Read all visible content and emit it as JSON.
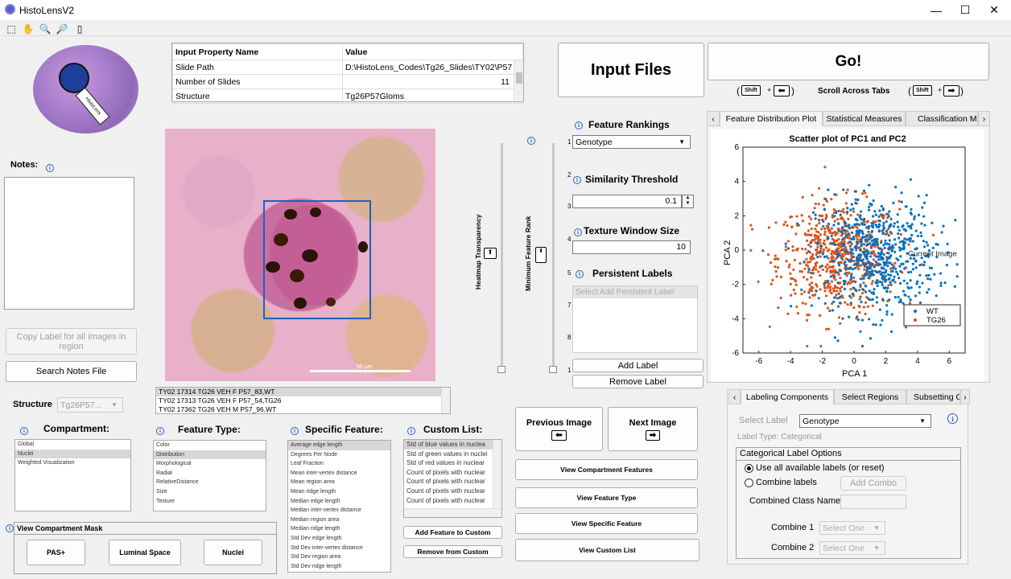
{
  "app": {
    "title": "HistoLensV2",
    "logo_text": "HistoLens"
  },
  "window": {
    "minimize": "—",
    "maximize": "☐",
    "close": "✕"
  },
  "toolbar": [
    "select-icon",
    "pan-icon",
    "zoom-in-icon",
    "zoom-out-icon",
    "data-cursor-icon"
  ],
  "input_table": {
    "headers": [
      "Input Property Name",
      "Value"
    ],
    "rows": [
      [
        "Slide Path",
        "D:\\HistoLens_Codes\\Tg26_Slides\\TY02\\P57"
      ],
      [
        "Number of Slides",
        "11"
      ],
      [
        "Structure",
        "Tg26P57Gloms"
      ]
    ]
  },
  "buttons": {
    "input_files": "Input Files",
    "go": "Go!",
    "copy_label": "Copy Label for all images in region",
    "search_notes": "Search Notes File",
    "previous_image": "Previous Image",
    "next_image": "Next Image",
    "view_compartment_features": "View Compartment Features",
    "view_feature_type": "View Feature Type",
    "view_specific_feature": "View Specific Feature",
    "view_custom_list": "View Custom List",
    "add_feature_to_custom": "Add Feature to Custom",
    "remove_from_custom": "Remove from Custom",
    "add_label": "Add Label",
    "remove_label": "Remove Label",
    "add_combo": "Add Combo",
    "pas": "PAS+",
    "luminal_space": "Luminal Space",
    "nuclei": "Nuclei"
  },
  "scroll_hint": {
    "shift": "Shift",
    "text": "Scroll Across Tabs",
    "plus": "+"
  },
  "notes": {
    "label": "Notes:"
  },
  "structure": {
    "label": "Structure",
    "value": "Tg26P57..."
  },
  "image": {
    "scale_label": "50 µm"
  },
  "image_list": [
    "TY02 17314 TG26 VEH F P57_83,WT",
    "TY02 17313 TG26 VEH F P57_54,TG26",
    "TY02 17362 TG26 VEH M P57_96,WT"
  ],
  "sliders": {
    "heatmap_label": "Heatmap Transparency",
    "rank_label": "Minimum Feature Rank",
    "ticks": [
      "1",
      "2",
      "3",
      "4",
      "5",
      "6",
      "7",
      "8",
      "1"
    ]
  },
  "feature_rankings": {
    "label": "Feature Rankings",
    "value": "Genotype"
  },
  "similarity": {
    "label": "Similarity Threshold",
    "value": "0.1"
  },
  "texture": {
    "label": "Texture Window Size",
    "value": "10"
  },
  "persistent": {
    "label": "Persistent Labels",
    "placeholder": "Select Add Persistent Label"
  },
  "compartment": {
    "label": "Compartment:",
    "items": [
      "Global",
      "Nuclei",
      "Weighted Visualization"
    ],
    "selected": 1
  },
  "feature_type": {
    "label": "Feature Type:",
    "items": [
      "Color",
      "Distribution",
      "Morphological",
      "Radial",
      "RelativeDistance",
      "Size",
      "Texture"
    ],
    "selected": 1
  },
  "specific_feature": {
    "label": "Specific Feature:",
    "items": [
      "Average edge length",
      "Degrees Per Node",
      "Leaf Fraction",
      "Mean inter-vertex distance",
      "Mean region area",
      "Mean ridge length",
      "Median edge length",
      "Median inter-vertex distance",
      "Median region area",
      "Median ridge length",
      "Std Dev edge length",
      "Std Dev inter-vertex distance",
      "Std Dev region area",
      "Std Dev ridge length"
    ],
    "selected": 0
  },
  "custom_list": {
    "label": "Custom List:",
    "items": [
      "Std of blue values in nuclea",
      "Std of green values in nuclei",
      "Std of red values in nuclear",
      "Count of pixels with nuclear",
      "Count of pixels with nuclear",
      "Count of pixels with nuclear",
      "Count of pixels with nuclear"
    ],
    "selected": 0
  },
  "compartment_mask": {
    "label": "View Compartment Mask"
  },
  "plot_tabs": [
    "Feature Distribution Plot",
    "Statistical Measures",
    "Classification Mo"
  ],
  "chart_data": {
    "type": "scatter",
    "title": "Scatter plot of PC1 and PC2",
    "xlabel": "PCA 1",
    "ylabel": "PCA 2",
    "xlim": [
      -7,
      7
    ],
    "ylim": [
      -6,
      6
    ],
    "xticks": [
      "-6",
      "-4",
      "-2",
      "0",
      "2",
      "4",
      "6"
    ],
    "yticks": [
      "-6",
      "-4",
      "-2",
      "0",
      "2",
      "4",
      "6"
    ],
    "annotation": "Current Image",
    "legend": "bottom-right",
    "series": [
      {
        "name": "WT",
        "color": "#0072bd",
        "count": 620,
        "center": [
          1.4,
          -0.3
        ],
        "spread": [
          1.9,
          1.7
        ]
      },
      {
        "name": "TG26",
        "color": "#d95319",
        "count": 620,
        "center": [
          -1.0,
          -0.4
        ],
        "spread": [
          1.9,
          1.6
        ]
      }
    ]
  },
  "label_tabs": [
    "Labeling Components",
    "Select Regions",
    "Subsetting C"
  ],
  "labeling": {
    "select_label": "Select Label",
    "select_value": "Genotype",
    "label_type": "Label Type: Categorical",
    "options_title": "Categorical Label Options",
    "use_all": "Use all available labels (or reset)",
    "combine": "Combine labels",
    "combined_name": "Combined Class Name",
    "combine1": "Combine 1",
    "combine2": "Combine 2",
    "select_one": "Select One"
  },
  "colors": {
    "accent": "#0072bd",
    "wt": "#0072bd",
    "tg26": "#d95319"
  }
}
